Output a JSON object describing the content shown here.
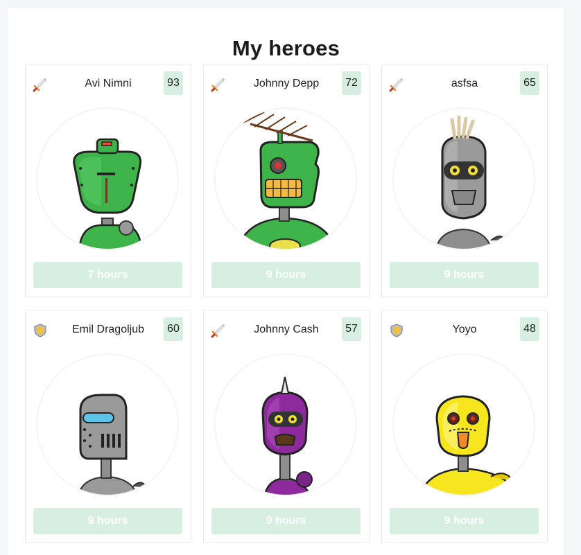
{
  "page": {
    "title": "My heroes"
  },
  "colors": {
    "accent_light": "#d6efe2",
    "card_border": "#e6e8ea"
  },
  "heroes": [
    {
      "name": "Avi Nimni",
      "level": "93",
      "type_icon": "sword-icon",
      "timer": "7 hours",
      "robot": "green-round-robot"
    },
    {
      "name": "Johnny Depp",
      "level": "72",
      "type_icon": "sword-icon",
      "timer": "9 hours",
      "robot": "green-antenna-robot"
    },
    {
      "name": "asfsa",
      "level": "65",
      "type_icon": "sword-icon",
      "timer": "9 hours",
      "robot": "gray-mohawk-robot"
    },
    {
      "name": "Emil Dragoljub",
      "level": "60",
      "type_icon": "shield-icon",
      "timer": "9 hours",
      "robot": "gray-visor-robot"
    },
    {
      "name": "Johnny Cash",
      "level": "57",
      "type_icon": "sword-icon",
      "timer": "9 hours",
      "robot": "purple-horn-robot"
    },
    {
      "name": "Yoyo",
      "level": "48",
      "type_icon": "shield-icon",
      "timer": "9 hours",
      "robot": "yellow-robot"
    }
  ]
}
